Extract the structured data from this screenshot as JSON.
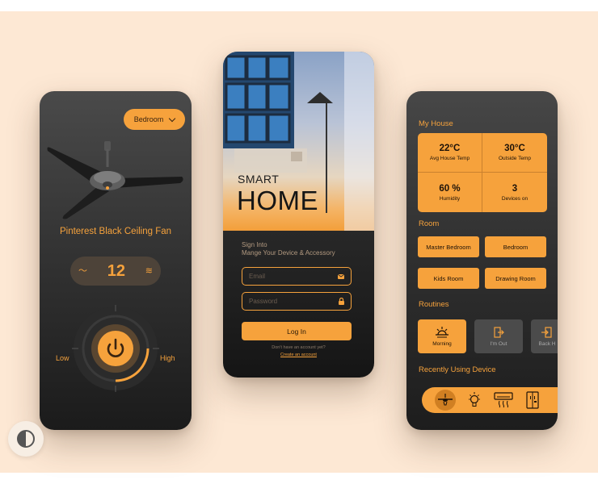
{
  "fan_screen": {
    "room_selector": "Bedroom",
    "device_name": "Pinterest Black Ceiling Fan",
    "speed": "12",
    "low_label": "Low",
    "high_label": "High",
    "power": "on"
  },
  "login_screen": {
    "hero_line1": "SMART",
    "hero_line2": "HOME",
    "signin_title": "Sign Into",
    "signin_subtitle": "Mange Your Device & Accessory",
    "email_placeholder": "Email",
    "password_placeholder": "Password",
    "login_button": "Log In",
    "no_account": "Don't have an account yet?",
    "create_account": "Create an account"
  },
  "dashboard_screen": {
    "my_house_title": "My House",
    "stats": [
      {
        "value": "22°C",
        "label": "Avg House Temp"
      },
      {
        "value": "30°C",
        "label": "Outside Temp"
      },
      {
        "value": "60 %",
        "label": "Humidity"
      },
      {
        "value": "3",
        "label": "Devices on"
      }
    ],
    "room_title": "Room",
    "rooms": [
      "Master Bedroom",
      "Bedroom",
      "Kids Room",
      "Drawing Room"
    ],
    "routines_title": "Routines",
    "routines": [
      {
        "label": "Morning",
        "icon": "sunrise-icon"
      },
      {
        "label": "I'm Out",
        "icon": "exit-door-icon"
      },
      {
        "label": "Back H",
        "icon": "enter-door-icon"
      }
    ],
    "recent_title": "Recently Using Device",
    "recent_devices": [
      "ceiling-fan-icon",
      "light-bulb-icon",
      "air-conditioner-icon",
      "refrigerator-icon"
    ]
  },
  "colors": {
    "accent": "#f6a23c",
    "background": "#fde8d4",
    "phone_dark": "#2a2a2a"
  }
}
